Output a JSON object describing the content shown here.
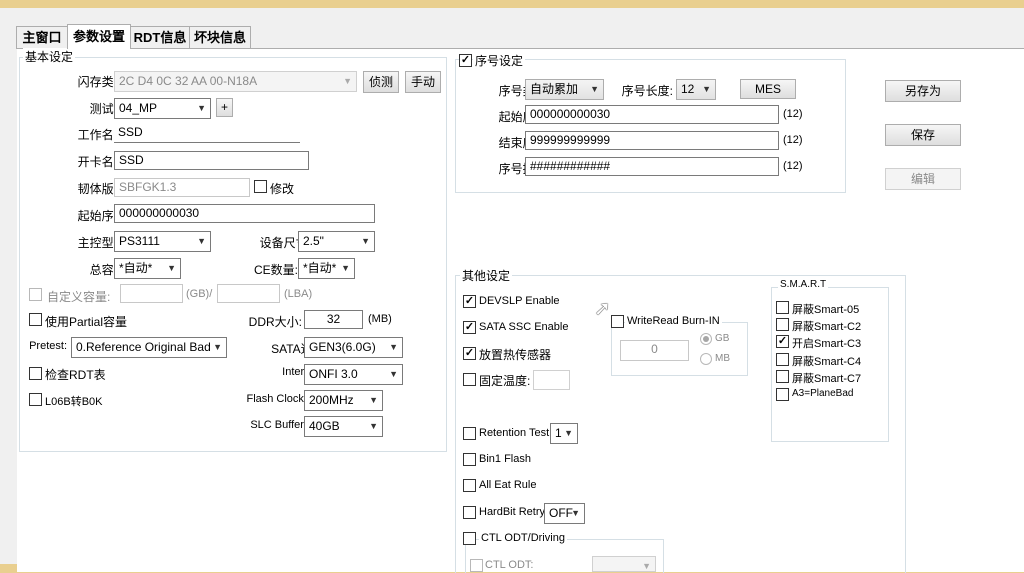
{
  "tabs": [
    "主窗口",
    "参数设置",
    "RDT信息",
    "坏块信息"
  ],
  "basic": {
    "title": "基本设定",
    "flash_type_label": "闪存类型:",
    "flash_type_value": "2C D4 0C 32 AA 00-N18A",
    "detect_btn": "侦测",
    "manual_btn": "手动",
    "test_station_label": "测试站:",
    "test_station_value": "04_MP",
    "plus_btn": "+",
    "work_name_label": "工作名称:",
    "work_name_value": "SSD",
    "card_name_label": "开卡名称:",
    "card_name_value": "SSD",
    "firmware_label": "韧体版本:",
    "firmware_value": "SBFGK1.3",
    "modify_label": "修改",
    "start_serial_label": "起始序号:",
    "start_serial_value": "000000000030",
    "controller_label": "主控型号:",
    "controller_value": "PS3111",
    "device_size_label": "设备尺寸:",
    "device_size_value": "2.5\"",
    "capacity_label": "总容量:",
    "capacity_value": "*自动*",
    "ce_label": "CE数量:",
    "ce_value": "*自动*",
    "custom_capacity_label": "自定义容量:",
    "gb_unit": "(GB)/",
    "lba_unit": "(LBA)",
    "partial_label": "使用Partial容量",
    "ddr_label": "DDR大小:",
    "ddr_value": "32",
    "mb_unit": "(MB)",
    "pretest_label": "Pretest:",
    "pretest_value": "0.Reference Original Bad",
    "sata_speed_label": "SATA速度:",
    "sata_speed_value": "GEN3(6.0G)",
    "check_rdt_label": "检查RDT表",
    "interface_label": "Interface:",
    "interface_value": "ONFI 3.0",
    "l06b_label": "L06B转B0K",
    "flash_clock_label": "Flash Clock:",
    "flash_clock_value": "200MHz",
    "slc_buffer_label": "SLC Buffer:",
    "slc_buffer_value": "40GB"
  },
  "serial": {
    "title": "序号设定",
    "checked": true,
    "type_label": "序号类型:",
    "type_value": "自动累加",
    "length_label": "序号长度:",
    "length_value": "12",
    "mes_btn": "MES",
    "start_label": "起始序号:",
    "start_value": "000000000030",
    "start_count": "(12)",
    "end_label": "结束序号:",
    "end_value": "999999999999",
    "end_count": "(12)",
    "mask_label": "序号掩码:",
    "mask_value": "############",
    "mask_count": "(12)"
  },
  "side_buttons": {
    "save_as": "另存为",
    "save": "保存",
    "edit": "编辑"
  },
  "other": {
    "title": "其他设定",
    "devslp": "DEVSLP Enable",
    "sata_ssc": "SATA SSC Enable",
    "thermal": "放置热传感器",
    "fixed_temp": "固定温度:",
    "writeread_title": "WriteRead Burn-IN",
    "writeread_value": "0",
    "gb_radio": "GB",
    "mb_radio": "MB",
    "retention": "Retention Test",
    "retention_value": "1",
    "bin1": "Bin1 Flash",
    "all_eat": "All Eat Rule",
    "hardbit": "HardBit Retry",
    "hardbit_value": "OFF",
    "ctl_odt_driving": "CTL ODT/Driving",
    "ctl_odt": "CTL ODT:"
  },
  "smart": {
    "title": "S.M.A.R.T",
    "items": [
      {
        "label": "屏蔽Smart-05",
        "checked": false
      },
      {
        "label": "屏蔽Smart-C2",
        "checked": false
      },
      {
        "label": "开启Smart-C3",
        "checked": true
      },
      {
        "label": "屏蔽Smart-C4",
        "checked": false
      },
      {
        "label": "屏蔽Smart-C7",
        "checked": false
      },
      {
        "label": "A3=PlaneBad",
        "checked": false
      }
    ]
  },
  "colors": {
    "window_frame": "#e9cf8f",
    "panel_bg": "#ffffff",
    "tab_bg": "#f0f0f0",
    "group_border": "#d5dfe5"
  }
}
